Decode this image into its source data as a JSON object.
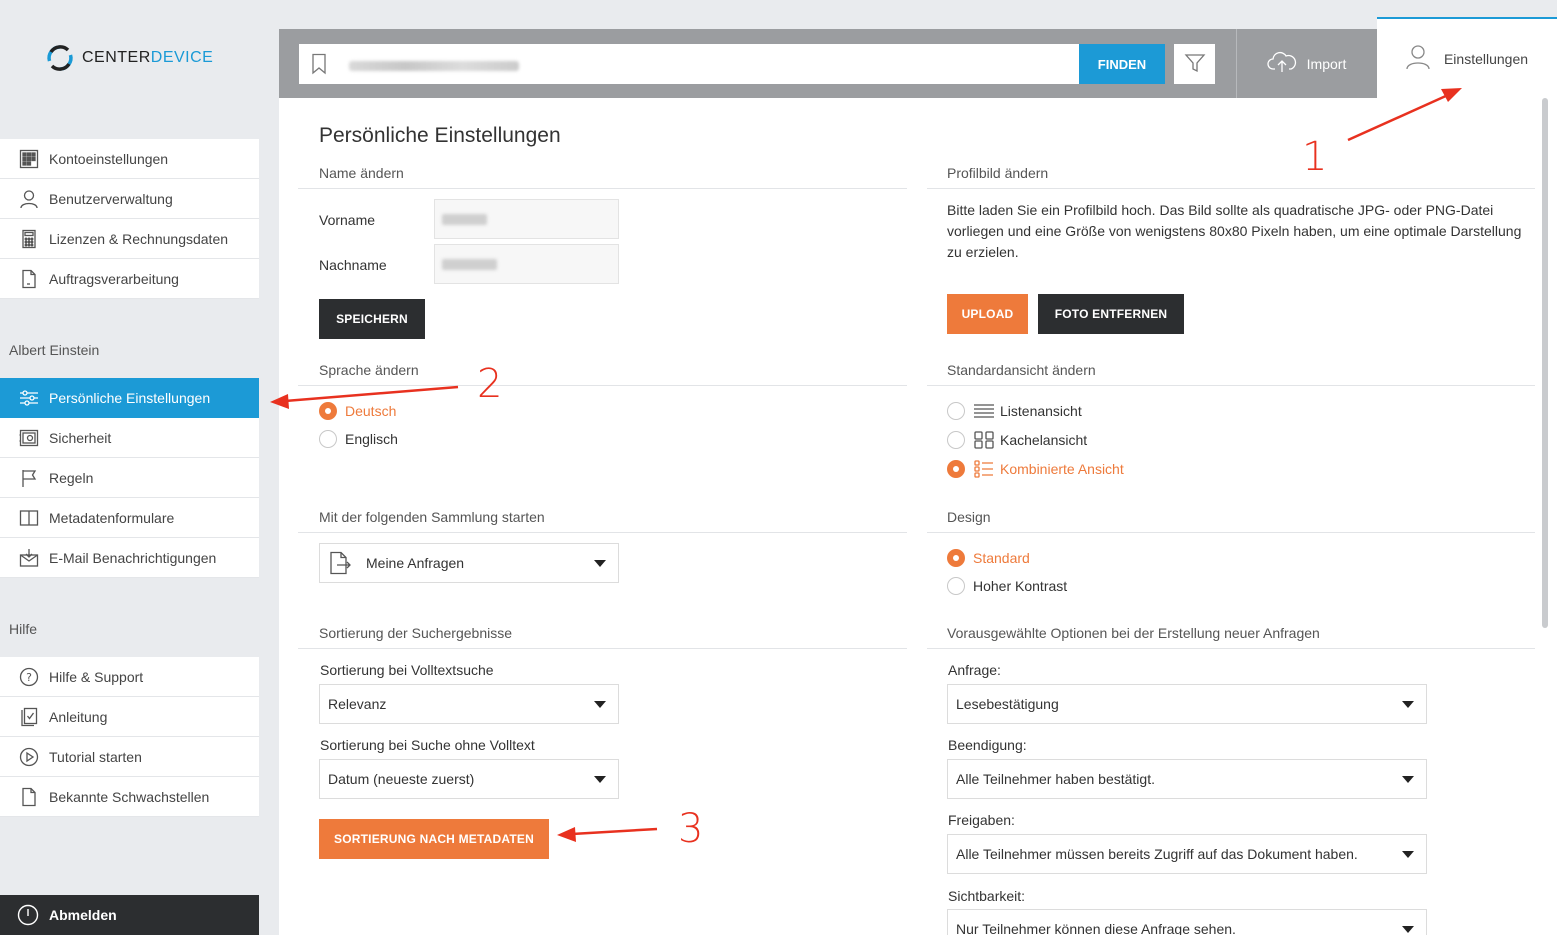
{
  "app": {
    "logo_text_1": "CENTER",
    "logo_text_2": "DEVICE"
  },
  "sidebar": {
    "account_items": [
      {
        "label": "Kontoeinstellungen",
        "icon": "grid-icon"
      },
      {
        "label": "Benutzerverwaltung",
        "icon": "user-icon"
      },
      {
        "label": "Lizenzen & Rechnungsdaten",
        "icon": "calculator-icon"
      },
      {
        "label": "Auftragsverarbeitung",
        "icon": "document-icon"
      }
    ],
    "user_section_title": "Albert Einstein",
    "user_items": [
      {
        "label": "Persönliche Einstellungen",
        "icon": "sliders-icon",
        "active": true
      },
      {
        "label": "Sicherheit",
        "icon": "safe-icon"
      },
      {
        "label": "Regeln",
        "icon": "flag-icon"
      },
      {
        "label": "Metadatenformulare",
        "icon": "book-icon"
      },
      {
        "label": "E-Mail Benachrichtigungen",
        "icon": "mail-icon"
      }
    ],
    "help_section_title": "Hilfe",
    "help_items": [
      {
        "label": "Hilfe & Support",
        "icon": "question-icon"
      },
      {
        "label": "Anleitung",
        "icon": "checklist-icon"
      },
      {
        "label": "Tutorial starten",
        "icon": "play-icon"
      },
      {
        "label": "Bekannte Schwachstellen",
        "icon": "document-icon"
      }
    ],
    "logout_label": "Abmelden"
  },
  "topbar": {
    "search_placeholder": "",
    "find_label": "FINDEN",
    "import_label": "Import",
    "settings_label": "Einstellungen"
  },
  "page": {
    "title": "Persönliche Einstellungen",
    "name": {
      "heading": "Name ändern",
      "first_name_label": "Vorname",
      "last_name_label": "Nachname",
      "save_label": "SPEICHERN"
    },
    "profile": {
      "heading": "Profilbild ändern",
      "text": "Bitte laden Sie ein Profilbild hoch. Das Bild sollte als quadratische JPG- oder PNG-Datei vorliegen und eine Größe von wenigstens 80x80 Pixeln haben, um eine optimale Darstellung zu erzielen.",
      "upload_label": "UPLOAD",
      "remove_label": "FOTO ENTFERNEN"
    },
    "language": {
      "heading": "Sprache ändern",
      "options": [
        {
          "label": "Deutsch",
          "checked": true
        },
        {
          "label": "Englisch",
          "checked": false
        }
      ]
    },
    "default_view": {
      "heading": "Standardansicht ändern",
      "options": [
        {
          "label": "Listenansicht",
          "checked": false,
          "icon": "list-icon"
        },
        {
          "label": "Kachelansicht",
          "checked": false,
          "icon": "tiles-icon"
        },
        {
          "label": "Kombinierte Ansicht",
          "checked": true,
          "icon": "combined-view-icon"
        }
      ]
    },
    "start_collection": {
      "heading": "Mit der folgenden Sammlung starten",
      "value": "Meine Anfragen"
    },
    "design": {
      "heading": "Design",
      "options": [
        {
          "label": "Standard",
          "checked": true
        },
        {
          "label": "Hoher Kontrast",
          "checked": false
        }
      ]
    },
    "sorting": {
      "heading": "Sortierung der Suchergebnisse",
      "fulltext_label": "Sortierung bei Volltextsuche",
      "fulltext_value": "Relevanz",
      "nofulltext_label": "Sortierung bei Suche ohne Volltext",
      "nofulltext_value": "Datum (neueste zuerst)",
      "metadata_button": "SORTIERUNG NACH METADATEN"
    },
    "request_options": {
      "heading": "Vorausgewählte Optionen bei der Erstellung neuer Anfragen",
      "request_label": "Anfrage:",
      "request_value": "Lesebestätigung",
      "completion_label": "Beendigung:",
      "completion_value": "Alle Teilnehmer haben bestätigt.",
      "shares_label": "Freigaben:",
      "shares_value": "Alle Teilnehmer müssen bereits Zugriff auf das Dokument haben.",
      "visibility_label": "Sichtbarkeit:",
      "visibility_value": "Nur Teilnehmer können diese Anfrage sehen."
    }
  },
  "annotations": {
    "n1": "1",
    "n2": "2",
    "n3": "3"
  },
  "colors": {
    "accent_blue": "#1c9ad6",
    "accent_orange": "#ee7a3b",
    "dark": "#2c2e30",
    "annotation_red": "#e8311f"
  }
}
